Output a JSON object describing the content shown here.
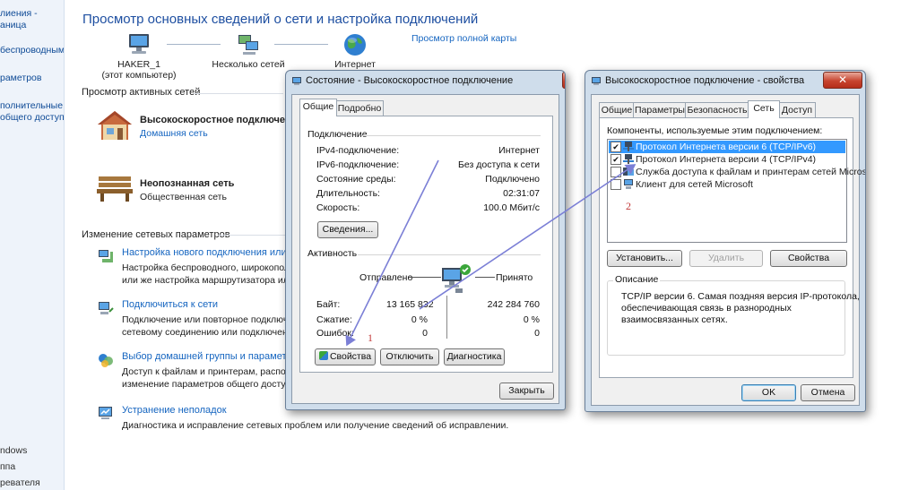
{
  "sidebar": {
    "items": [
      "лиения -",
      "аница",
      "беспроводными",
      "раметров",
      "полнительные",
      "общего доступа"
    ],
    "bottom": [
      "ndows",
      "ппа",
      "ревателя"
    ]
  },
  "main": {
    "title": "Просмотр основных сведений о сети и настройка подключений",
    "full_map_link": "Просмотр полной карты",
    "map": {
      "computer": "HAKER_1",
      "computer_sub": "(этот компьютер)",
      "networks": "Несколько сетей",
      "internet": "Интернет"
    },
    "active_header": "Просмотр активных сетей",
    "active_networks": [
      {
        "name": "Высокоскоростное подключение",
        "type": "Домашняя сеть"
      },
      {
        "name": "Неопознанная сеть",
        "type": "Общественная сеть"
      }
    ],
    "change_header": "Изменение сетевых параметров",
    "tasks": [
      {
        "title": "Настройка нового подключения или се",
        "lines": [
          "Настройка беспроводного, широкопол",
          "или же настройка маршрутизатора или"
        ]
      },
      {
        "title": "Подключиться к сети",
        "lines": [
          "Подключение или повторное подключ",
          "сетевому соединению или подключен"
        ]
      },
      {
        "title": "Выбор домашней группы и параметров",
        "lines": [
          "Доступ к файлам и принтерам, располо",
          "изменение параметров общего доступа"
        ]
      },
      {
        "title": "Устранение неполадок",
        "lines": [
          "Диагностика и исправление сетевых проблем или получение сведений об исправлении."
        ]
      }
    ]
  },
  "status_window": {
    "title": "Состояние - Высокоскоростное подключение",
    "close": "✕",
    "tabs": [
      "Общие",
      "Подробно"
    ],
    "connection_header": "Подключение",
    "rows": [
      {
        "label": "IPv4-подключение:",
        "value": "Интернет"
      },
      {
        "label": "IPv6-подключение:",
        "value": "Без доступа к сети"
      },
      {
        "label": "Состояние среды:",
        "value": "Подключено"
      },
      {
        "label": "Длительность:",
        "value": "02:31:07"
      },
      {
        "label": "Скорость:",
        "value": "100.0 Мбит/с"
      }
    ],
    "details_btn": "Сведения...",
    "activity_header": "Активность",
    "sent": "Отправлено",
    "received": "Принято",
    "stats": [
      {
        "label": "Байт:",
        "sent": "13 165 832",
        "received": "242 284 760"
      },
      {
        "label": "Сжатие:",
        "sent": "0 %",
        "received": "0 %"
      },
      {
        "label": "Ошибок:",
        "sent": "0",
        "received": "0"
      }
    ],
    "buttons": {
      "properties": "Свойства",
      "disable": "Отключить",
      "diagnose": "Диагностика",
      "close": "Закрыть"
    }
  },
  "props_window": {
    "title": "Высокоскоростное подключение - свойства",
    "close": "✕",
    "tabs": [
      "Общие",
      "Параметры",
      "Безопасность",
      "Сеть",
      "Доступ"
    ],
    "components_label": "Компоненты, используемые этим подключением:",
    "components": [
      {
        "label": "Протокол Интернета версии 6 (TCP/IPv6)",
        "checked": true,
        "selected": true
      },
      {
        "label": "Протокол Интернета версии 4 (TCP/IPv4)",
        "checked": true,
        "selected": false
      },
      {
        "label": "Служба доступа к файлам и принтерам сетей Microsoft",
        "checked": false,
        "selected": false
      },
      {
        "label": "Клиент для сетей Microsoft",
        "checked": false,
        "selected": false
      }
    ],
    "buttons": {
      "install": "Установить...",
      "remove": "Удалить",
      "properties": "Свойства",
      "ok": "OK",
      "cancel": "Отмена"
    },
    "description_header": "Описание",
    "description": [
      "TCP/IP версии 6. Самая поздняя версия IP-протокола,",
      "обеспечивающая связь в разнородных",
      "взаимосвязанных сетях."
    ]
  },
  "annotations": {
    "step1": "1",
    "step2": "2"
  },
  "colors": {
    "link": "#1565c0",
    "accent_arrow": "#7b7fd6",
    "annotation": "#c23a3a",
    "selected_row": "#3399ff"
  }
}
